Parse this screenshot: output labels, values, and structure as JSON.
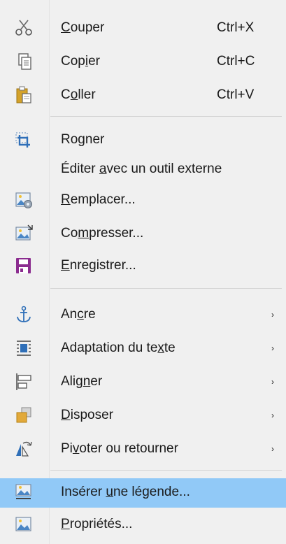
{
  "menu": {
    "items": [
      {
        "pre": "",
        "ul": "C",
        "post": "ouper",
        "shortcut": "Ctrl+X",
        "icon": "scissors-icon"
      },
      {
        "pre": "Cop",
        "ul": "i",
        "post": "er",
        "shortcut": "Ctrl+C",
        "icon": "copy-icon"
      },
      {
        "pre": "C",
        "ul": "o",
        "post": "ller",
        "shortcut": "Ctrl+V",
        "icon": "paste-icon"
      },
      {
        "pre": "Ro",
        "ul": "g",
        "post": "ner",
        "shortcut": "",
        "icon": "crop-icon"
      },
      {
        "pre": "Éditer ",
        "ul": "a",
        "post": "vec un outil externe",
        "shortcut": "",
        "icon": ""
      },
      {
        "pre": "",
        "ul": "R",
        "post": "emplacer...",
        "shortcut": "",
        "icon": "replace-image-icon"
      },
      {
        "pre": "Co",
        "ul": "m",
        "post": "presser...",
        "shortcut": "",
        "icon": "compress-image-icon"
      },
      {
        "pre": "",
        "ul": "E",
        "post": "nregistrer...",
        "shortcut": "",
        "icon": "save-icon"
      },
      {
        "pre": "An",
        "ul": "c",
        "post": "re",
        "shortcut": "",
        "icon": "anchor-icon",
        "submenu": true
      },
      {
        "pre": "Adaptation du te",
        "ul": "x",
        "post": "te",
        "shortcut": "",
        "icon": "text-wrap-icon",
        "submenu": true
      },
      {
        "pre": "Alig",
        "ul": "n",
        "post": "er",
        "shortcut": "",
        "icon": "align-icon",
        "submenu": true
      },
      {
        "pre": "",
        "ul": "D",
        "post": "isposer",
        "shortcut": "",
        "icon": "arrange-icon",
        "submenu": true
      },
      {
        "pre": "Pi",
        "ul": "v",
        "post": "oter ou retourner",
        "shortcut": "",
        "icon": "rotate-flip-icon",
        "submenu": true
      },
      {
        "pre": "Insérer ",
        "ul": "u",
        "post": "ne légende...",
        "shortcut": "",
        "icon": "insert-caption-icon",
        "selected": true
      },
      {
        "pre": "",
        "ul": "P",
        "post": "ropriétés...",
        "shortcut": "",
        "icon": "properties-icon"
      }
    ],
    "submenu_arrow": "›"
  },
  "colors": {
    "menu_bg": "#f0f0f0",
    "selected_bg": "#91c9f7",
    "save_icon": "#8b2c8f",
    "anchor_icon": "#2f6fb8",
    "paste_icon": "#d4a22a"
  }
}
